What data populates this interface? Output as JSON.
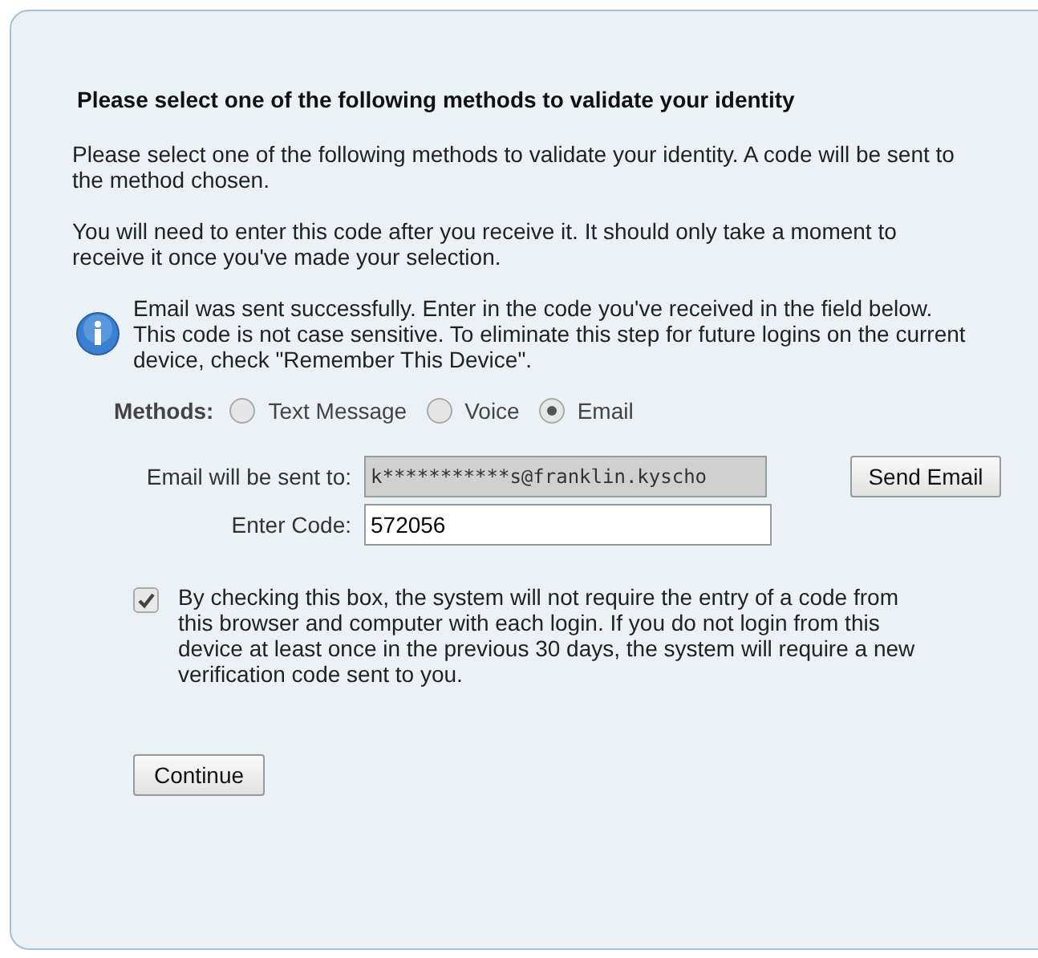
{
  "heading": "Please select one of the following methods to validate your identity",
  "paragraphs": [
    "Please select one of the following methods to validate your identity. A code will be sent to the method chosen.",
    "You will need to enter this code after you receive it. It should only take a moment to receive it once you've made your selection."
  ],
  "notice": "Email was sent successfully. Enter in the code you've received in the field below. This code is not case sensitive. To eliminate this step for future logins on the current device, check \"Remember This Device\".",
  "methods": {
    "label": "Methods:",
    "options": [
      {
        "label": "Text Message",
        "selected": false
      },
      {
        "label": "Voice",
        "selected": false
      },
      {
        "label": "Email",
        "selected": true
      }
    ]
  },
  "email_row": {
    "label": "Email will be sent to:",
    "value": "k***********s@franklin.kyscho",
    "disabled": true,
    "button": "Send Email"
  },
  "code_row": {
    "label": "Enter Code:",
    "value": "572056"
  },
  "remember": {
    "checked": true,
    "text": "By checking this box, the system will not require the entry of a code from this browser and computer with each login. If you do not login from this device at least once in the previous 30 days, the system will require a new verification code sent to you."
  },
  "continue_button": "Continue"
}
